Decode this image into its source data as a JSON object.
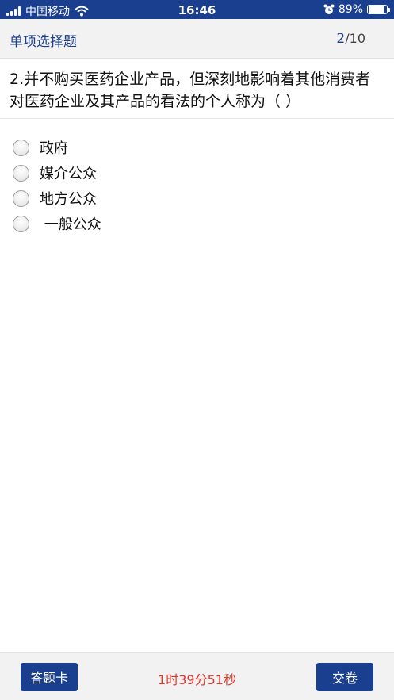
{
  "status_bar": {
    "carrier": "中国移动",
    "time": "16:46",
    "battery_text": "89%",
    "battery_level": 0.89,
    "icons": [
      "signal-icon",
      "wifi-icon",
      "alarm-icon",
      "battery-icon"
    ]
  },
  "header": {
    "title": "单项选择题",
    "current": "2",
    "total": "/10"
  },
  "question": {
    "text": "2.并不购买医药企业产品，但深刻地影响着其他消费者对医药企业及其产品的看法的个人称为（ ）"
  },
  "options": [
    {
      "label": "政府"
    },
    {
      "label": "媒介公众"
    },
    {
      "label": "地方公众"
    },
    {
      "label": " 一般公众"
    }
  ],
  "footer": {
    "card_label": "答题卡",
    "timer": "1时39分51秒",
    "submit_label": "交卷"
  },
  "colors": {
    "primary": "#1b3f8f",
    "timer": "#e0362c",
    "header_bg": "#f2f2f2"
  }
}
